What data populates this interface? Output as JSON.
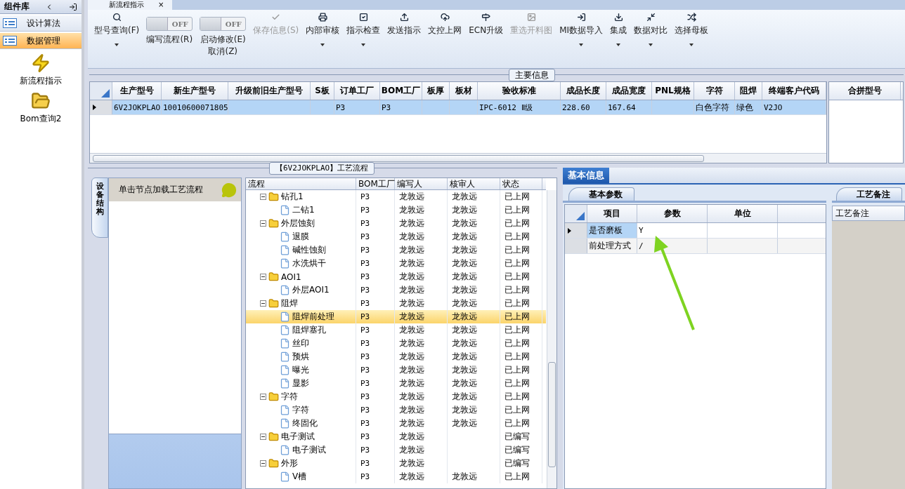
{
  "sidebar": {
    "title": "组件库",
    "groups": [
      {
        "label": "设计算法",
        "selected": false
      },
      {
        "label": "数据管理",
        "selected": true
      }
    ],
    "items": [
      {
        "label": "新流程指示"
      },
      {
        "label": "Bom查询2"
      }
    ]
  },
  "document_tab": {
    "label": "新流程指示",
    "close": "×"
  },
  "toolbar": [
    {
      "kind": "button",
      "label": "型号查询(F)",
      "dropdown": true,
      "disabled": false
    },
    {
      "kind": "toggle",
      "label": "编写流程(R)",
      "state_label": "OFF",
      "on": false
    },
    {
      "kind": "toggle",
      "label": "启动修改(E)",
      "sublabel": "取消(Z)",
      "state_label": "OFF",
      "on": false
    },
    {
      "kind": "button",
      "label": "保存信息(S)",
      "dropdown": false,
      "disabled": true
    },
    {
      "kind": "button",
      "label": "内部审核",
      "dropdown": true,
      "disabled": false
    },
    {
      "kind": "button",
      "label": "指示检查",
      "dropdown": true,
      "disabled": false
    },
    {
      "kind": "button",
      "label": "发送指示",
      "dropdown": false,
      "disabled": false
    },
    {
      "kind": "button",
      "label": "文控上网",
      "dropdown": false,
      "disabled": false
    },
    {
      "kind": "button",
      "label": "ECN升级",
      "dropdown": false,
      "disabled": false
    },
    {
      "kind": "button",
      "label": "重选开料图",
      "dropdown": false,
      "disabled": true
    },
    {
      "kind": "button",
      "label": "MI数据导入",
      "dropdown": true,
      "disabled": false
    },
    {
      "kind": "button",
      "label": "集成",
      "dropdown": true,
      "disabled": false
    },
    {
      "kind": "button",
      "label": "数据对比",
      "dropdown": true,
      "disabled": false
    },
    {
      "kind": "button",
      "label": "选择母板",
      "dropdown": true,
      "disabled": false
    }
  ],
  "main_info": {
    "title": "主要信息",
    "columns": [
      "生产型号",
      "新生产型号",
      "升级前旧生产型号",
      "S板",
      "订单工厂",
      "BOM工厂",
      "板厚",
      "板材",
      "验收标准",
      "成品长度",
      "成品宽度",
      "PNL规格",
      "字符",
      "阻焊",
      "终端客户代码"
    ],
    "rows": [
      {
        "selected": true,
        "cells": [
          "6V2JOKPLAO",
          "10010600071805",
          null,
          null,
          "P3",
          "P3",
          null,
          null,
          "IPC-6012 Ⅱ级",
          "228.60",
          "167.64",
          null,
          "白色字符",
          "绿色",
          "V2JO"
        ]
      }
    ],
    "side_column": "合拼型号"
  },
  "process": {
    "title": "【6V2JOKPLAO】工艺流程",
    "side_tab": "设备结构",
    "hint": "单击节点加载工艺流程",
    "columns": [
      "流程",
      "BOM工厂",
      "编写人",
      "核审人",
      "状态"
    ],
    "tree": [
      {
        "name": "钻孔1",
        "factory": "P3",
        "writer": "龙敦远",
        "reviewer": "龙敦远",
        "status": "已上网",
        "selected": false,
        "expanded": true,
        "children": [
          {
            "name": "二钻1",
            "factory": "P3",
            "writer": "龙敦远",
            "reviewer": "龙敦远",
            "status": "已上网",
            "selected": false
          }
        ]
      },
      {
        "name": "外层蚀刻",
        "factory": "P3",
        "writer": "龙敦远",
        "reviewer": "龙敦远",
        "status": "已上网",
        "selected": false,
        "expanded": true,
        "children": [
          {
            "name": "退膜",
            "factory": "P3",
            "writer": "龙敦远",
            "reviewer": "龙敦远",
            "status": "已上网",
            "selected": false
          },
          {
            "name": "碱性蚀刻",
            "factory": "P3",
            "writer": "龙敦远",
            "reviewer": "龙敦远",
            "status": "已上网",
            "selected": false
          },
          {
            "name": "水洗烘干",
            "factory": "P3",
            "writer": "龙敦远",
            "reviewer": "龙敦远",
            "status": "已上网",
            "selected": false
          }
        ]
      },
      {
        "name": "AOI1",
        "factory": "P3",
        "writer": "龙敦远",
        "reviewer": "龙敦远",
        "status": "已上网",
        "selected": false,
        "expanded": true,
        "children": [
          {
            "name": "外层AOI1",
            "factory": "P3",
            "writer": "龙敦远",
            "reviewer": "龙敦远",
            "status": "已上网",
            "selected": false
          }
        ]
      },
      {
        "name": "阻焊",
        "factory": "P3",
        "writer": "龙敦远",
        "reviewer": "龙敦远",
        "status": "已上网",
        "selected": false,
        "expanded": true,
        "children": [
          {
            "name": "阻焊前处理",
            "factory": "P3",
            "writer": "龙敦远",
            "reviewer": "龙敦远",
            "status": "已上网",
            "selected": true
          },
          {
            "name": "阻焊塞孔",
            "factory": "P3",
            "writer": "龙敦远",
            "reviewer": "龙敦远",
            "status": "已上网",
            "selected": false
          },
          {
            "name": "丝印",
            "factory": "P3",
            "writer": "龙敦远",
            "reviewer": "龙敦远",
            "status": "已上网",
            "selected": false
          },
          {
            "name": "预烘",
            "factory": "P3",
            "writer": "龙敦远",
            "reviewer": "龙敦远",
            "status": "已上网",
            "selected": false
          },
          {
            "name": "曝光",
            "factory": "P3",
            "writer": "龙敦远",
            "reviewer": "龙敦远",
            "status": "已上网",
            "selected": false
          },
          {
            "name": "显影",
            "factory": "P3",
            "writer": "龙敦远",
            "reviewer": "龙敦远",
            "status": "已上网",
            "selected": false
          }
        ]
      },
      {
        "name": "字符",
        "factory": "P3",
        "writer": "龙敦远",
        "reviewer": "龙敦远",
        "status": "已上网",
        "selected": false,
        "expanded": true,
        "children": [
          {
            "name": "字符",
            "factory": "P3",
            "writer": "龙敦远",
            "reviewer": "龙敦远",
            "status": "已上网",
            "selected": false
          },
          {
            "name": "终固化",
            "factory": "P3",
            "writer": "龙敦远",
            "reviewer": "龙敦远",
            "status": "已上网",
            "selected": false
          }
        ]
      },
      {
        "name": "电子测试",
        "factory": "P3",
        "writer": "龙敦远",
        "status": "已编写",
        "selected": false,
        "expanded": true,
        "children": [
          {
            "name": "电子测试",
            "factory": "P3",
            "writer": "龙敦远",
            "status": "已编写",
            "selected": false
          }
        ]
      },
      {
        "name": "外形",
        "factory": "P3",
        "writer": "龙敦远",
        "status": "已编写",
        "selected": false,
        "expanded": true,
        "children": [
          {
            "name": "V槽",
            "factory": "P3",
            "writer": "龙敦远",
            "reviewer": "龙敦远",
            "status": "已上网",
            "selected": false
          }
        ]
      }
    ]
  },
  "detail": {
    "tab": "基本信息",
    "subtab": "基本参数",
    "columns": [
      "项目",
      "参数",
      "单位"
    ],
    "rows": [
      {
        "item": "是否磨板",
        "value": "Y",
        "selected": true
      },
      {
        "item": "前处理方式",
        "value": "/",
        "selected": false
      }
    ],
    "notes_tab": "工艺备注",
    "notes_header": "工艺备注"
  }
}
